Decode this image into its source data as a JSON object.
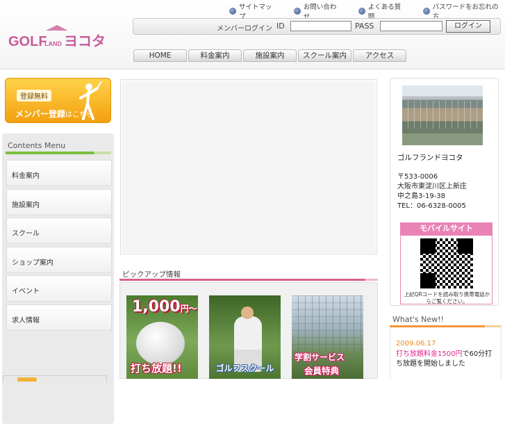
{
  "header": {
    "logo_text": "GOLF LAND ヨコタ",
    "top_links": [
      {
        "label": "サイトマップ",
        "icon": "globe-icon"
      },
      {
        "label": "お問い合わせ",
        "icon": "globe-icon"
      },
      {
        "label": "よくある質問",
        "icon": "globe-icon"
      },
      {
        "label": "パスワードをお忘れの方",
        "icon": "globe-icon"
      }
    ],
    "login": {
      "label": "メンバーログイン",
      "id_label": "ID",
      "id_value": "",
      "pass_label": "PASS",
      "pass_value": "",
      "button": "ログイン"
    },
    "nav": [
      "HOME",
      "料金案内",
      "施設案内",
      "スクール案内",
      "アクセス"
    ]
  },
  "sidebar": {
    "register_banner": {
      "small": "登録無料",
      "big": "メンバー登録",
      "suffix": "はこちら"
    },
    "menu_title": "Contents Menu",
    "menu_items": [
      "料金案内",
      "施設案内",
      "スクール",
      "ショップ案内",
      "イベント",
      "求人情報"
    ]
  },
  "main": {
    "pickup_title": "ピックアップ情報",
    "pickups": [
      {
        "big": "1,000",
        "unit": "円～",
        "caption": "打ち放題!!"
      },
      {
        "caption": "ゴルフスクール"
      },
      {
        "caption1": "学割サービス",
        "caption2": "会員特典"
      }
    ]
  },
  "right": {
    "shop_name": "ゴルフランドヨコタ",
    "address_lines": [
      "〒533-0006",
      "大阪市東淀川区上新庄",
      "中之島3-19-38",
      "TEL：06-6328-0005"
    ],
    "mobile_title": "モバイルサイト",
    "qr_caption": "上記QRコードを読み取り携帯電話からご覧ください。",
    "news_title": "What's New!!",
    "news": [
      {
        "date": "2009.06.17",
        "highlight": "打ち放題料金1500円",
        "body": "で60分打ち放題を開始しました"
      }
    ]
  },
  "colors": {
    "pink": "#ea83b5",
    "green": "#7cbe3e",
    "orange": "#f19735",
    "banner": "#f3a00f"
  }
}
